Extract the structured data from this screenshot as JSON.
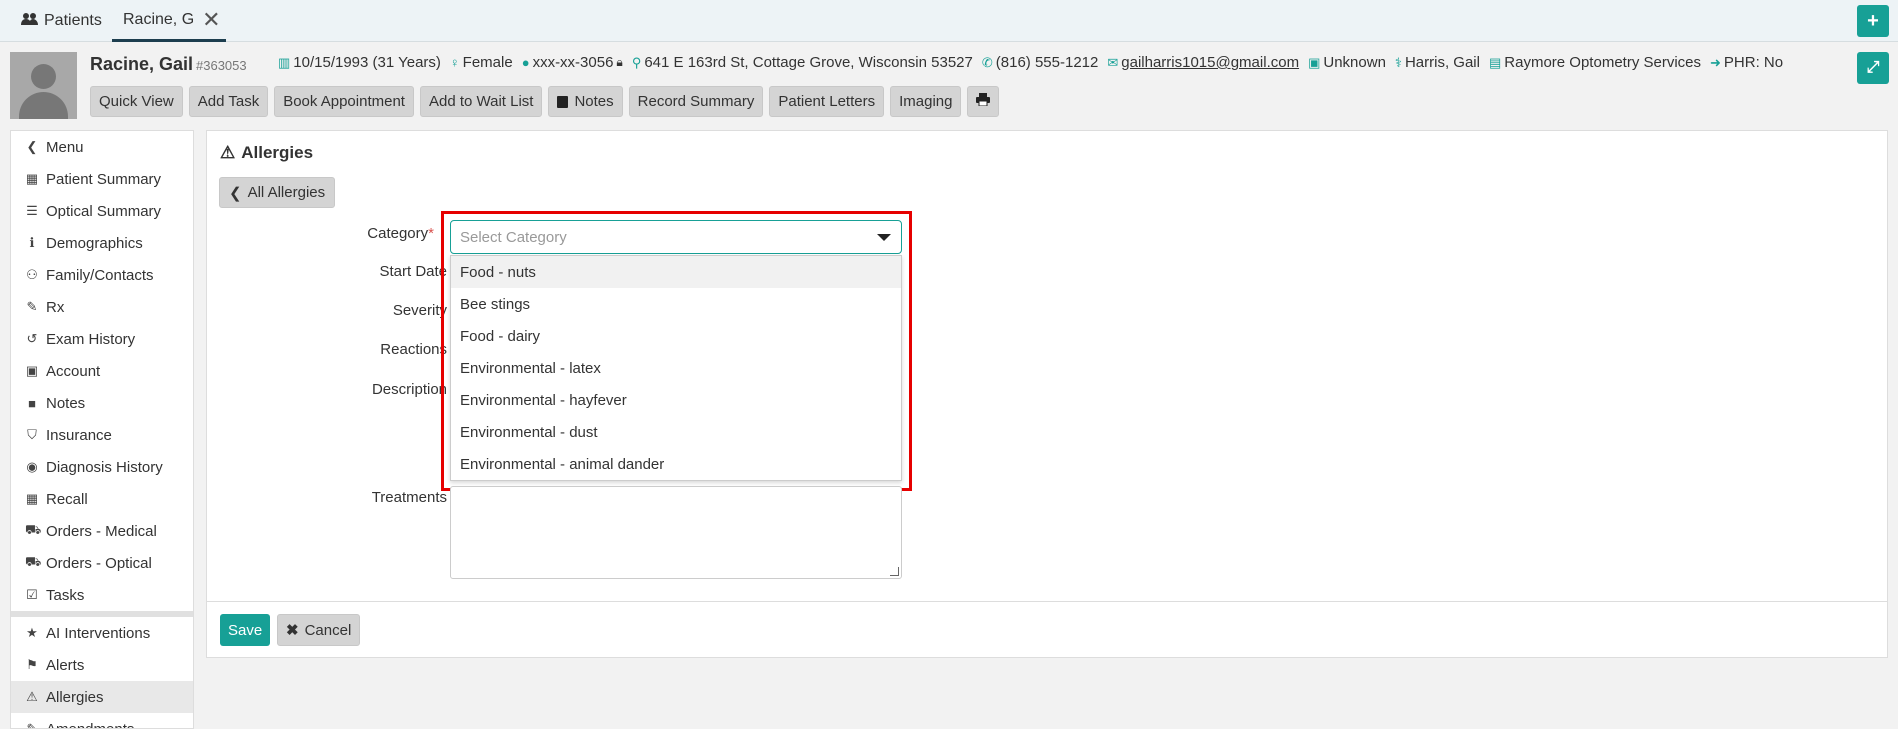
{
  "tabs": {
    "patients_label": "Patients",
    "patient_tab_label": "Racine, G",
    "close_glyph": "✕"
  },
  "header": {
    "patient_name": "Racine, Gail",
    "patient_id": "#363053",
    "dob": "10/15/1993 (31 Years)",
    "gender": "Female",
    "ssn": "xxx-xx-3056",
    "address": "641 E 163rd St, Cottage Grove, Wisconsin 53527",
    "phone": "(816) 555-1212",
    "email": "gailharris1015@gmail.com",
    "employment": "Unknown",
    "provider": "Harris, Gail",
    "location": "Raymore Optometry Services",
    "phr": "PHR: No"
  },
  "toolbar": {
    "quick_view": "Quick View",
    "add_task": "Add Task",
    "book_appointment": "Book Appointment",
    "add_to_wait_list": "Add to Wait List",
    "notes": "Notes",
    "record_summary": "Record Summary",
    "patient_letters": "Patient Letters",
    "imaging": "Imaging"
  },
  "sidebar": {
    "items": [
      {
        "label": "Menu",
        "icon": "chevron-left-icon"
      },
      {
        "label": "Patient Summary",
        "icon": "grid-icon"
      },
      {
        "label": "Optical Summary",
        "icon": "list-icon"
      },
      {
        "label": "Demographics",
        "icon": "info-icon"
      },
      {
        "label": "Family/Contacts",
        "icon": "users-icon"
      },
      {
        "label": "Rx",
        "icon": "edit-icon"
      },
      {
        "label": "Exam History",
        "icon": "history-icon"
      },
      {
        "label": "Account",
        "icon": "money-icon"
      },
      {
        "label": "Notes",
        "icon": "note-icon"
      },
      {
        "label": "Insurance",
        "icon": "shield-icon"
      },
      {
        "label": "Diagnosis History",
        "icon": "eye-icon"
      },
      {
        "label": "Recall",
        "icon": "calendar-icon"
      },
      {
        "label": "Orders - Medical",
        "icon": "cart-icon"
      },
      {
        "label": "Orders - Optical",
        "icon": "cart-icon"
      },
      {
        "label": "Tasks",
        "icon": "check-square-icon"
      },
      {
        "label": "AI Interventions",
        "icon": "star-icon"
      },
      {
        "label": "Alerts",
        "icon": "flag-icon"
      },
      {
        "label": "Allergies",
        "icon": "warning-icon"
      },
      {
        "label": "Amendments",
        "icon": "edit-icon"
      }
    ]
  },
  "main": {
    "title": "Allergies",
    "back_label": "All Allergies",
    "fields": {
      "category": "Category",
      "start_date": "Start Date",
      "severity": "Severity",
      "reactions": "Reactions",
      "description": "Description",
      "treatments": "Treatments"
    },
    "required_mark": "*",
    "category_placeholder": "Select Category",
    "category_options": [
      "Food - nuts",
      "Bee stings",
      "Food - dairy",
      "Environmental - latex",
      "Environmental - hayfever",
      "Environmental - dust",
      "Environmental - animal dander"
    ],
    "save_label": "Save",
    "cancel_label": "Cancel"
  },
  "colors": {
    "accent": "#17a096",
    "highlight_box": "#e60000"
  }
}
